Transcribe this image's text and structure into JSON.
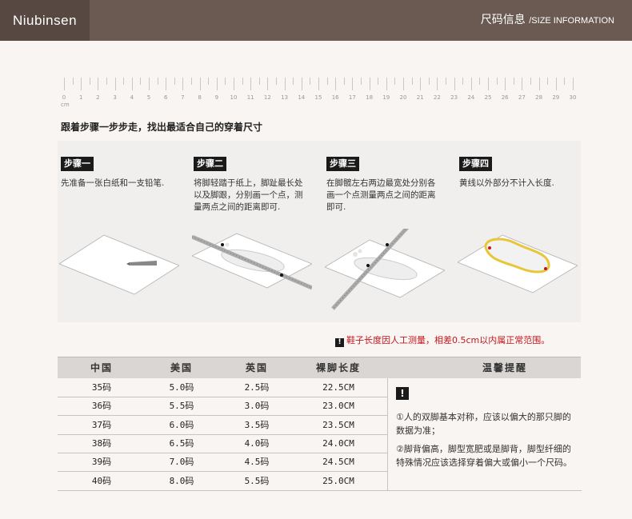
{
  "header": {
    "brand": "Niubinsen",
    "title_cn": "尺码信息",
    "title_en": "/SIZE INFORMATION"
  },
  "ruler": {
    "numbers": [
      "0",
      "1",
      "2",
      "3",
      "4",
      "5",
      "6",
      "7",
      "8",
      "9",
      "10",
      "11",
      "12",
      "13",
      "14",
      "15",
      "16",
      "17",
      "18",
      "19",
      "20",
      "21",
      "22",
      "23",
      "24",
      "25",
      "26",
      "27",
      "28",
      "29",
      "30"
    ],
    "unit": "cm"
  },
  "guide": "跟着步骤一步步走，找出最适合自己的穿着尺寸",
  "steps": [
    {
      "label": "步骤一",
      "desc": "先准备一张白纸和一支铅笔."
    },
    {
      "label": "步骤二",
      "desc": "将脚轻踏于纸上，脚趾最长处以及脚跟，分别画一个点，测量两点之间的距离即可."
    },
    {
      "label": "步骤三",
      "desc": "在脚髋左右两边最宽处分别各画一个点测量两点之间的距离即可."
    },
    {
      "label": "步骤四",
      "desc": "黄线以外部分不计入长度."
    }
  ],
  "notice": {
    "mark": "!",
    "text": "鞋子长度因人工测量，相差0.5cm以内属正常范围。"
  },
  "table": {
    "headers": [
      "中国",
      "美国",
      "英国",
      "裸脚长度",
      "温馨提醒"
    ],
    "rows": [
      [
        "35码",
        "5.0码",
        "2.5码",
        "22.5CM"
      ],
      [
        "36码",
        "5.5码",
        "3.0码",
        "23.0CM"
      ],
      [
        "37码",
        "6.0码",
        "3.5码",
        "23.5CM"
      ],
      [
        "38码",
        "6.5码",
        "4.0码",
        "24.0CM"
      ],
      [
        "39码",
        "7.0码",
        "4.5码",
        "24.5CM"
      ],
      [
        "40码",
        "8.0码",
        "5.5码",
        "25.0CM"
      ]
    ],
    "tip_mark": "!",
    "tips": [
      "①人的双脚基本对称，应该以偏大的那只脚的数据为准；",
      "②脚背偏高，脚型宽肥或是脚背，脚型纤细的特殊情况应该选择穿着偏大或偏小一个尺码。"
    ]
  },
  "colors": {
    "header_bg": "#6a5a51",
    "brand_bg": "#574941",
    "notice_red": "#c4161c",
    "pencil_line": "#e8c63a"
  }
}
